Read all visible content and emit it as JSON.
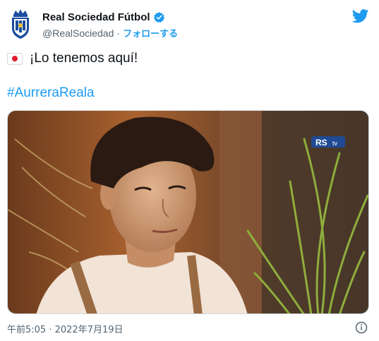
{
  "account": {
    "display_name": "Real Sociedad Fútbol",
    "handle": "@RealSociedad",
    "separator": "·",
    "follow_label": "フォローする"
  },
  "tweet": {
    "text": "¡Lo tenemos aquí!",
    "hashtag": "#AurreraReala",
    "flag_icon": "japan-flag-icon"
  },
  "media": {
    "watermark": "RS",
    "watermark_sub": "tv"
  },
  "footer": {
    "timestamp": "午前5:05 · 2022年7月19日"
  },
  "colors": {
    "accent": "#1d9bf0",
    "text": "#0f1419",
    "muted": "#536471"
  }
}
